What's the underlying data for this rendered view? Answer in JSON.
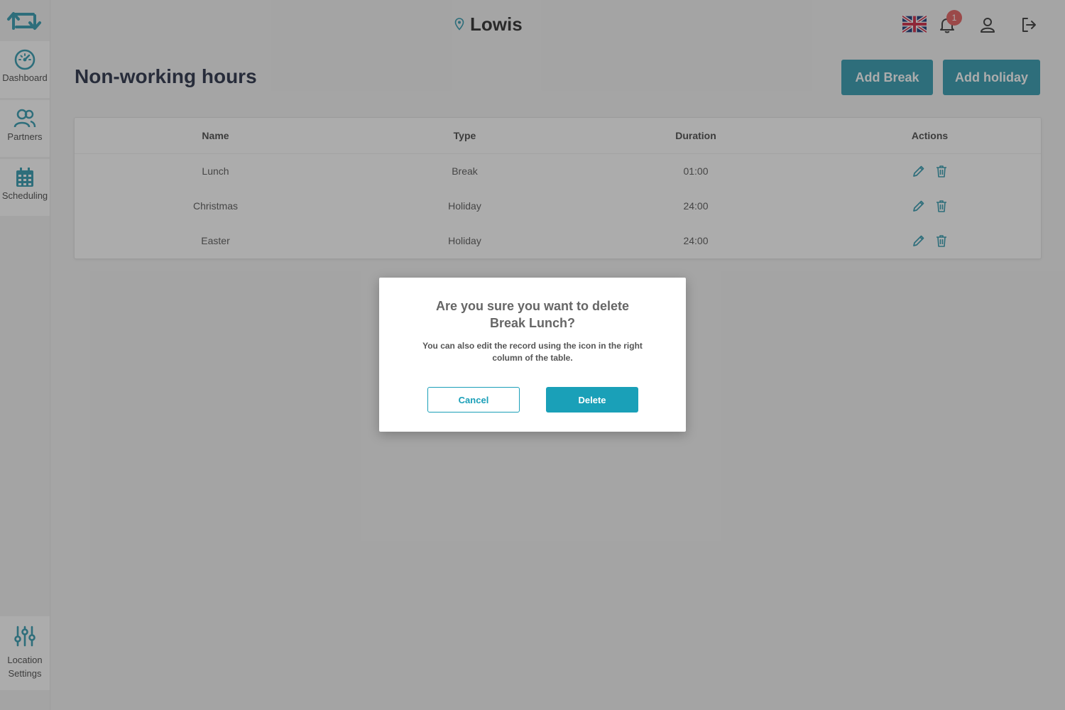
{
  "colors": {
    "accent": "#1a8fa6",
    "badge": "#e04b4b",
    "title": "#0e1730"
  },
  "header": {
    "location_name": "Lowis",
    "language_flag": "uk-flag-icon",
    "notifications_count": "1"
  },
  "sidebar": {
    "items": [
      {
        "label": "Dashboard",
        "icon": "gauge-icon"
      },
      {
        "label": "Partners",
        "icon": "users-icon"
      },
      {
        "label": "Scheduling",
        "icon": "calendar-icon"
      }
    ],
    "bottom": {
      "label_line1": "Location",
      "label_line2": "Settings",
      "icon": "sliders-icon"
    }
  },
  "page": {
    "title": "Non-working hours",
    "add_break_label": "Add Break",
    "add_holiday_label": "Add holiday"
  },
  "table": {
    "columns": [
      "Name",
      "Type",
      "Duration",
      "Actions"
    ],
    "rows": [
      {
        "name": "Lunch",
        "type": "Break",
        "duration": "01:00"
      },
      {
        "name": "Christmas",
        "type": "Holiday",
        "duration": "24:00"
      },
      {
        "name": "Easter",
        "type": "Holiday",
        "duration": "24:00"
      }
    ]
  },
  "modal": {
    "title": "Are you sure you want to delete Break Lunch?",
    "text": "You can also edit the record using the icon in the right column of the table.",
    "cancel_label": "Cancel",
    "delete_label": "Delete"
  }
}
